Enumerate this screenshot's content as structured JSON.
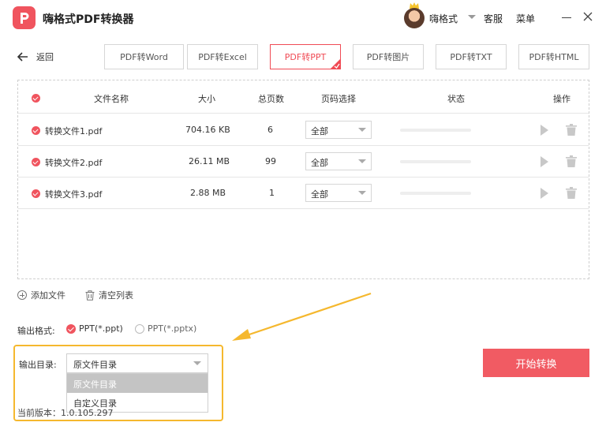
{
  "app": {
    "title": "嗨格式PDF转换器",
    "username": "嗨格式",
    "support_label": "客服",
    "menu_label": "菜单"
  },
  "nav": {
    "back_label": "返回",
    "tabs": [
      {
        "label": "PDF转Word",
        "active": false
      },
      {
        "label": "PDF转Excel",
        "active": false
      },
      {
        "label": "PDF转PPT",
        "active": true
      },
      {
        "label": "PDF转图片",
        "active": false
      },
      {
        "label": "PDF转TXT",
        "active": false
      },
      {
        "label": "PDF转HTML",
        "active": false
      }
    ]
  },
  "table": {
    "headers": {
      "name": "文件名称",
      "size": "大小",
      "pages": "总页数",
      "page_select": "页码选择",
      "status": "状态",
      "actions": "操作"
    },
    "rows": [
      {
        "name": "转换文件1.pdf",
        "size": "704.16 KB",
        "pages": "6",
        "page_select": "全部",
        "progress": 0
      },
      {
        "name": "转换文件2.pdf",
        "size": "26.11 MB",
        "pages": "99",
        "page_select": "全部",
        "progress": 0
      },
      {
        "name": "转换文件3.pdf",
        "size": "2.88 MB",
        "pages": "1",
        "page_select": "全部",
        "progress": 0
      }
    ]
  },
  "actions": {
    "add_file": "添加文件",
    "clear_list": "清空列表"
  },
  "output": {
    "format_label": "输出格式:",
    "format_options": [
      "PPT(*.ppt)",
      "PPT(*.pptx)"
    ],
    "format_selected": "PPT(*.ppt)",
    "dir_label": "输出目录:",
    "dir_selected": "原文件目录",
    "dir_options": [
      "原文件目录",
      "自定义目录"
    ]
  },
  "start_button": "开始转换",
  "version": "当前版本：1.0.105.297",
  "colors": {
    "accent": "#f0545e",
    "highlight": "#f5b82e"
  }
}
